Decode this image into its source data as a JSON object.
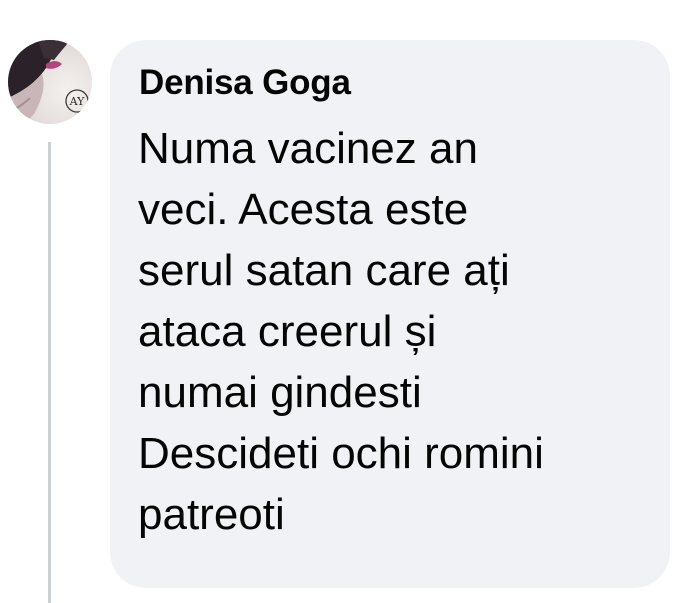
{
  "comment": {
    "author": "Denisa Goga",
    "lines": [
      "Numa vacinez an",
      "veci. Acesta este",
      "serul satan care ați",
      "ataca creerul și",
      "numai gindesti",
      "Descideti ochi romini",
      "patreoti"
    ]
  },
  "avatar": {
    "icon": "profile-photo",
    "monogram": "AY"
  },
  "colors": {
    "bubble_background": "#f0f2f5",
    "thread_line": "#ccd0d5",
    "text": "#050505"
  }
}
